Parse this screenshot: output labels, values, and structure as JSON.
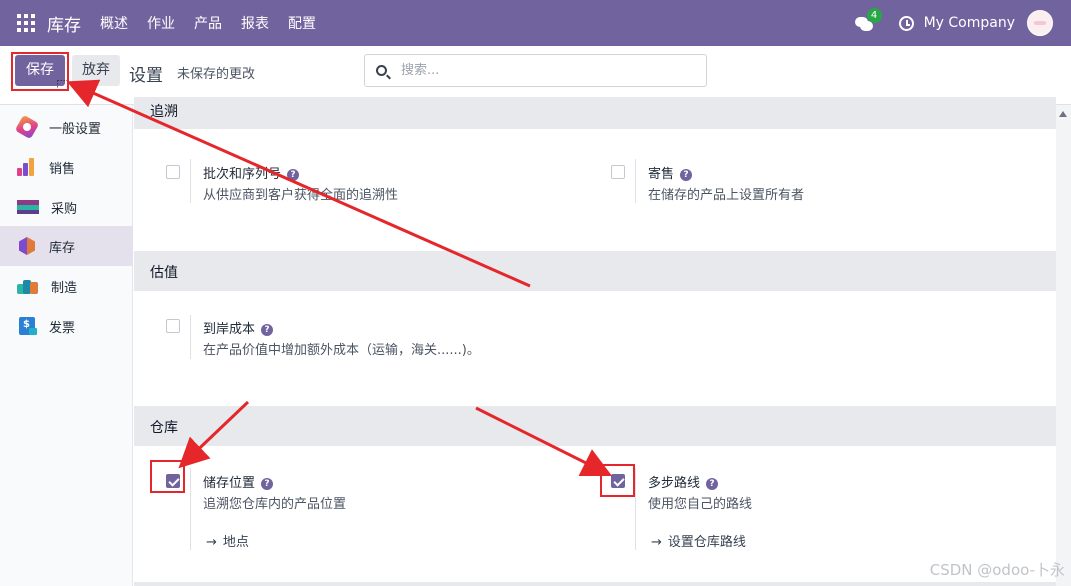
{
  "navbar": {
    "brand": "库存",
    "menu": [
      "概述",
      "作业",
      "产品",
      "报表",
      "配置"
    ],
    "message_count": "4",
    "company": "My Company",
    "bg_color": "#71639e"
  },
  "control": {
    "save_label": "保存",
    "discard_label": "放弃",
    "title": "设置",
    "unsaved": "未保存的更改",
    "search_placeholder": "搜索..."
  },
  "sidebar": {
    "items": [
      {
        "label": "一般设置",
        "icon": "general-settings-icon"
      },
      {
        "label": "销售",
        "icon": "sales-icon"
      },
      {
        "label": "采购",
        "icon": "purchase-icon"
      },
      {
        "label": "库存",
        "icon": "inventory-icon",
        "active": true
      },
      {
        "label": "制造",
        "icon": "manufacturing-icon"
      },
      {
        "label": "发票",
        "icon": "invoicing-icon"
      }
    ]
  },
  "sections": {
    "traceability": {
      "title": "追溯",
      "lots": {
        "title": "批次和序列号",
        "desc": "从供应商到客户获得全面的追溯性",
        "checked": false
      },
      "consignment": {
        "title": "寄售",
        "desc": "在储存的产品上设置所有者",
        "checked": false
      }
    },
    "valuation": {
      "title": "估值",
      "landed": {
        "title": "到岸成本",
        "desc": "在产品价值中增加额外成本（运输，海关......)。",
        "checked": false
      }
    },
    "warehouse": {
      "title": "仓库",
      "locations": {
        "title": "储存位置",
        "desc": "追溯您仓库内的产品位置",
        "link": "地点",
        "checked": true
      },
      "routes": {
        "title": "多步路线",
        "desc": "使用您自己的路线",
        "link": "设置仓库路线",
        "checked": true
      }
    }
  },
  "watermark": "CSDN @odoo-卜永",
  "annotation_color": "#e5262b"
}
